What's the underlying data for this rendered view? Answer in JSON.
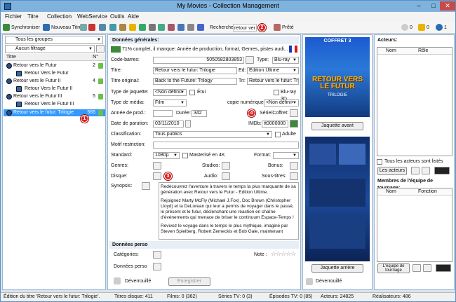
{
  "window": {
    "title": "My Movies - Collection Management"
  },
  "menu": [
    "Fichier",
    "Titre",
    "Collection",
    "WebService",
    "Outils",
    "Aide"
  ],
  "toolbar": {
    "sync_label": "Synchroniser",
    "new_title_label": "Nouveau Titre",
    "search_label": "Recherche:",
    "search_value": "retour ver",
    "ready_label": "Prêté",
    "err_count": "0",
    "warn_count": "0",
    "info_count": "1"
  },
  "left": {
    "group_filter": "Tous les groupes",
    "filter": "Aucun filtrage",
    "col_title": "Titre",
    "col_num": "N°",
    "rows": [
      {
        "label": "Retour vers le Futur",
        "count": "2"
      },
      {
        "label": "Retour Vers le Futur",
        "count": ""
      },
      {
        "label": "Retour vers le Futur II",
        "count": "4"
      },
      {
        "label": "Retour Vers le Futur II",
        "count": ""
      },
      {
        "label": "Retour vers le Futur III",
        "count": "5"
      },
      {
        "label": "Retour Vers le Futur III",
        "count": ""
      },
      {
        "label": "Retour vers le futur: Trilogie",
        "count": "565"
      }
    ]
  },
  "general": {
    "header": "Données générales:",
    "completeness": "71% complet, il manque: Année de production, format, Genres, pistes audi...",
    "barcode_label": "Code-barres:",
    "barcode": "5050582803853",
    "type_label": "Type:",
    "type": "Blu-ray",
    "title_label": "Titre:",
    "title": "Retour vers le futur: Trilogie",
    "ed_label": "Ed:",
    "edition": "Edition Ultime",
    "orig_label": "Titre original:",
    "orig": "Back to the Future: Trilogy",
    "sort_label": "Tri:",
    "sort": "Retour vers le futur: Trilogie",
    "jacket_label": "Type de jaquette:",
    "jacket": "<Non défini>",
    "etui_label": "Étui",
    "bluray3d_label": "Blu-ray 3D",
    "media_label": "Type de média:",
    "media": "Film",
    "digital_label": "copie numérique:",
    "digital": "<Non défini>",
    "year_label": "Année de prod.:",
    "year": "",
    "duration_label": "Durée:",
    "duration": "342",
    "series_label": "Série/Coffret:",
    "release_label": "Date de parution:",
    "release": "03/11/2010",
    "imdb_label": "IMDb:",
    "imdb": "tt0000000",
    "class_label": "Classification:",
    "class": "Tous publics",
    "adult_label": "Adulte",
    "restrict_label": "Motif restriction:",
    "standard_label": "Standard:",
    "standard": "1080p",
    "mastered_label": "Masterisé en 4K",
    "format_label": "Format:",
    "genres_label": "Genres:",
    "studios_label": "Studios:",
    "bonus_label": "Bonus:",
    "disc_label": "Disque:",
    "audio_label": "Audio:",
    "subs_label": "Sous-titres:",
    "synopsis_label": "Synopsis:",
    "synopsis": [
      "Redécouvrez l'aventure à travers le temps la plus marquante de sa génération avec Retour vers le Futur - Edition Ultime.",
      "Rejoignez Marty McFly (Michael J.Fox), Doc Brown (Christopher Lloyd) et la DeLorean qui leur a permis de voyager dans le passé, le présent et le futur, déclenchant une réaction en chaîne d'événements qui menace de briser le continuum Espace-Temps !",
      "Revivez le voyage dans le temps le plus mythique, imaginé par Steven Spielberg, Robert Zemeckis et Bob Gale, maintenant"
    ]
  },
  "perso": {
    "header": "Données perso",
    "cat_label": "Catégories:",
    "note_label": "Note :",
    "data_label": "Données perso",
    "unlock_label": "Déverrouillé",
    "save_label": "Enregistrer"
  },
  "covers": {
    "front_title": "COFFRET 3",
    "front_logo": "RETOUR VERS LE FUTUR",
    "front_sub": "TRILOGIE",
    "front_btn": "Jaquette avant",
    "back_btn": "Jaquette arrière",
    "unlock": "Déverrouillé"
  },
  "actors": {
    "header": "Acteurs:",
    "col_name": "Nom",
    "col_role": "Rôle",
    "all_label": "Tous les acteurs sont listés",
    "actors_btn": "Les acteurs",
    "crew_header": "Membres de l'équipe de tournage:",
    "col_function": "Fonction",
    "crew_btn": "L'équipe de tournage"
  },
  "status": {
    "edit": "Édition du titre 'Retour vers le futur: Trilogie'.",
    "discs": "Titres disque: 411",
    "films": "Films: 0 (362)",
    "tv": "Séries TV: 0 (3)",
    "episodes": "Épisodes TV: 0 (85)",
    "actors": "Acteurs: 24825",
    "directors": "Réalisateurs: 486"
  },
  "badges": [
    "1",
    "2",
    "3",
    "4"
  ],
  "colors": {
    "selected": "#3399ff",
    "badge": "#e02020",
    "titlebar": "#7fb2dc"
  }
}
